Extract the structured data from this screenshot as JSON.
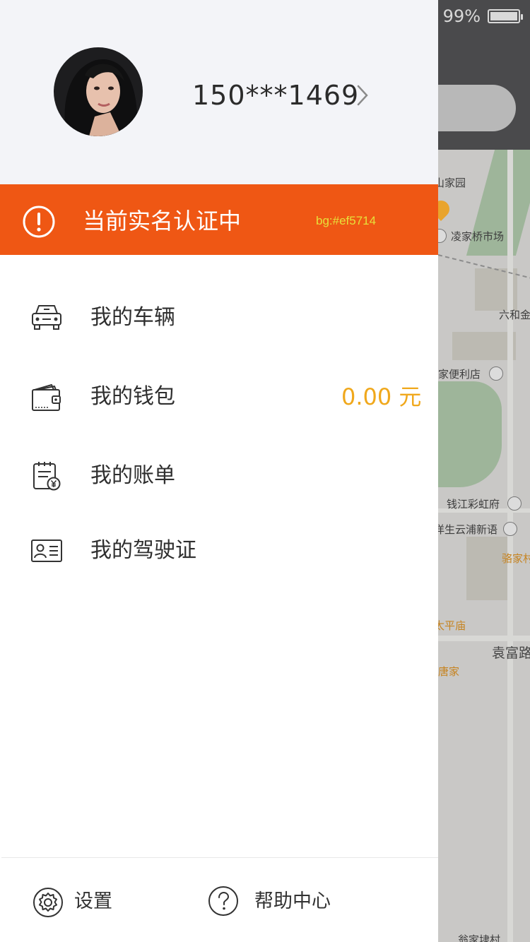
{
  "status_bar": {
    "battery_text": "99%"
  },
  "map": {
    "labels": [
      "山家园",
      "凌家桥市场",
      "六和金",
      "家便利店",
      "钱江彩虹府",
      "洋生云浦新语",
      "骆家村",
      "太平庙",
      "袁富路",
      "唐家",
      "翁家埭村"
    ]
  },
  "profile": {
    "phone": "150***1469"
  },
  "auth_banner": {
    "text": "当前实名认证中",
    "note": "bg:#ef5714",
    "color": "#ef5714"
  },
  "menu": {
    "vehicles": "我的车辆",
    "wallet": "我的钱包",
    "wallet_value": "0.00 元",
    "bills": "我的账单",
    "license": "我的驾驶证"
  },
  "footer": {
    "settings": "设置",
    "help": "帮助中心"
  },
  "icons": {
    "avatar": "user-avatar-photo",
    "chevron": "chevron-right-icon",
    "alert": "alert-circle-icon",
    "car": "car-icon",
    "wallet": "wallet-icon",
    "bill": "bill-icon",
    "license": "id-card-icon",
    "settings": "gear-icon",
    "help": "help-circle-icon"
  },
  "colors": {
    "accent_orange": "#ef5714",
    "wallet_value": "#f0a81c",
    "profile_bg": "#f3f4f8"
  }
}
